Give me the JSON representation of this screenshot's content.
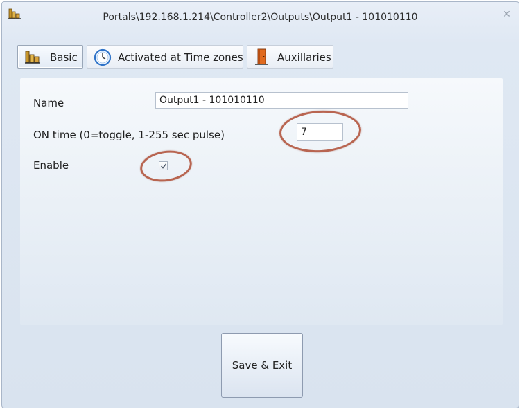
{
  "window": {
    "title": "Portals\\192.168.1.214\\Controller2\\Outputs\\Output1 - 101010110",
    "close_symbol": "✕"
  },
  "tabs": [
    {
      "label": "Basic",
      "icon": "building-icon",
      "active": true
    },
    {
      "label": "Activated at Time zones",
      "icon": "clock-icon",
      "active": false
    },
    {
      "label": "Auxillaries",
      "icon": "door-icon",
      "active": false
    }
  ],
  "form": {
    "name_label": "Name",
    "name_value": "Output1 - 101010110",
    "on_time_label": "ON time (0=toggle, 1-255 sec pulse)",
    "on_time_value": "7",
    "enable_label": "Enable",
    "enable_checked": true
  },
  "footer": {
    "save_label": "Save & Exit"
  },
  "colors": {
    "highlight_ring": "#b3563f",
    "accent": "#dfe8f3"
  }
}
